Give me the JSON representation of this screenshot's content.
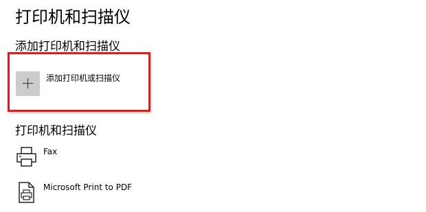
{
  "header": {
    "title": "打印机和扫描仪"
  },
  "add_section": {
    "title": "添加打印机和扫描仪",
    "add_button": {
      "label": "添加打印机或扫描仪",
      "icon": "plus-icon"
    },
    "highlight_color": "#e21b1b"
  },
  "devices_section": {
    "title": "打印机和扫描仪",
    "devices": [
      {
        "name": "Fax",
        "icon": "printer-icon"
      },
      {
        "name": "Microsoft Print to PDF",
        "icon": "pdf-printer-icon"
      }
    ]
  },
  "colors": {
    "add_tile_background": "#cccccc"
  }
}
